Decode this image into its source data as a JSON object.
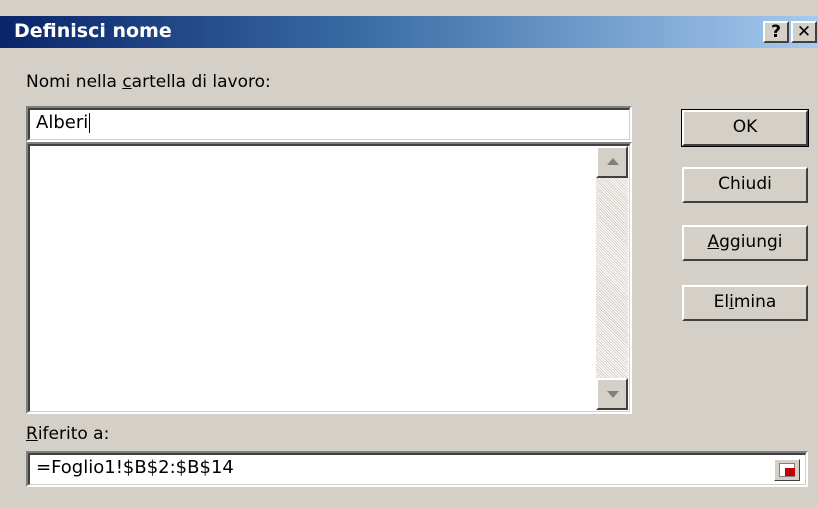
{
  "window": {
    "title": "Definisci nome",
    "help_glyph": "?",
    "close_glyph": "✕"
  },
  "names_label": {
    "before": "Nomi nella ",
    "accel": "c",
    "after": "artella di lavoro:"
  },
  "name_input": {
    "value": "Alberi"
  },
  "names_list": {
    "items": []
  },
  "buttons": {
    "ok": "OK",
    "close": "Chiudi",
    "add": {
      "accel": "A",
      "rest": "ggiungi"
    },
    "delete": {
      "before": "El",
      "accel": "i",
      "after": "mina"
    }
  },
  "ref_label": {
    "accel": "R",
    "rest": "iferito a:"
  },
  "ref_input": {
    "value": "=Foglio1!$B$2:$B$14"
  },
  "colors": {
    "title_start": "#0a246a",
    "title_end": "#a6caf0",
    "face": "#d4d0c8"
  },
  "icons": {
    "scroll_up": "triangle-up-icon",
    "scroll_down": "triangle-down-icon",
    "collapse_dialog": "range-select-icon"
  }
}
